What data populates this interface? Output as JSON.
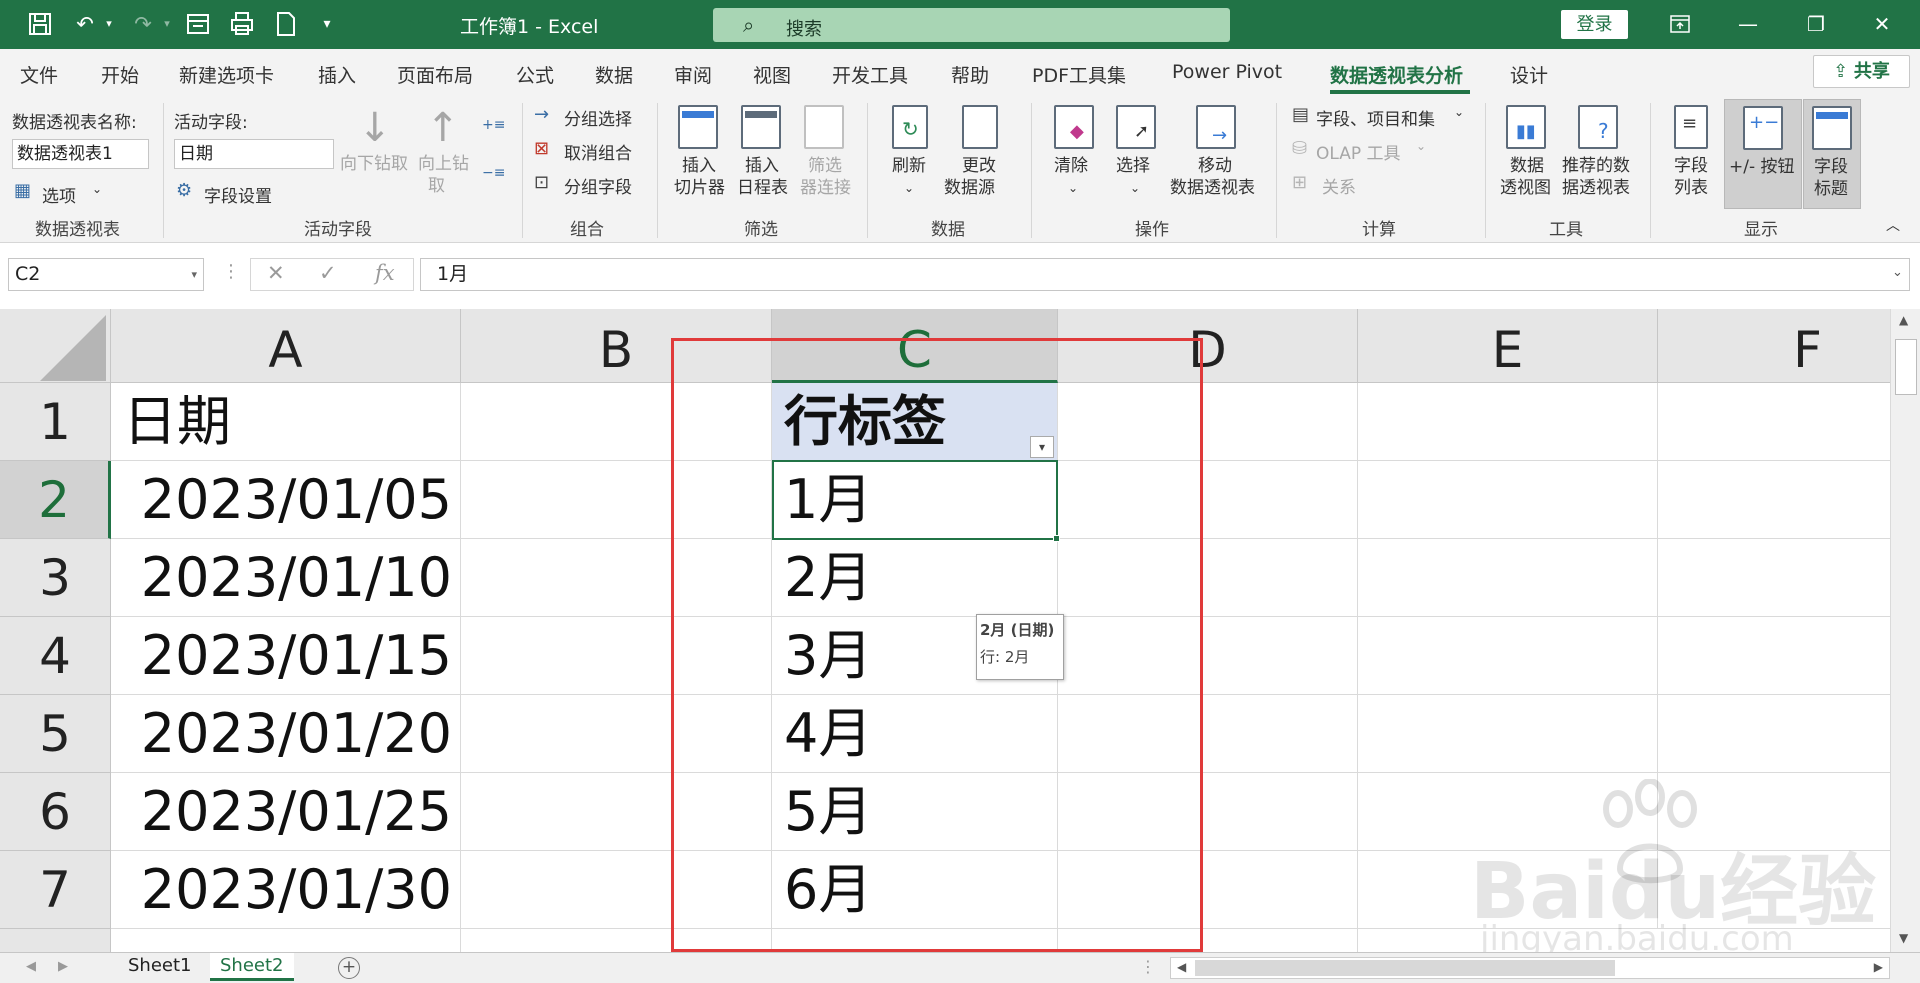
{
  "titlebar": {
    "doc_title": "工作簿1  -  Excel",
    "search_placeholder": "搜索",
    "login_label": "登录"
  },
  "menu": {
    "tabs": [
      "文件",
      "开始",
      "新建选项卡",
      "插入",
      "页面布局",
      "公式",
      "数据",
      "审阅",
      "视图",
      "开发工具",
      "帮助",
      "PDF工具集",
      "Power Pivot",
      "数据透视表分析",
      "设计"
    ],
    "active_tab": "数据透视表分析",
    "share_label": "共享"
  },
  "ribbon": {
    "pivot": {
      "name_label": "数据透视表名称:",
      "name_value": "数据透视表1",
      "options_label": "选项",
      "group_label": "数据透视表"
    },
    "active_field": {
      "label": "活动字段:",
      "value": "日期",
      "settings_label": "字段设置",
      "drill_down": "向下钻取",
      "drill_up_1": "向上钻",
      "drill_up_2": "取",
      "group_label": "活动字段"
    },
    "group": {
      "group_selection": "分组选择",
      "ungroup": "取消组合",
      "group_field": "分组字段",
      "group_label": "组合"
    },
    "filter": {
      "slicer_1": "插入",
      "slicer_2": "切片器",
      "timeline_1": "插入",
      "timeline_2": "日程表",
      "conn_1": "筛选",
      "conn_2": "器连接",
      "group_label": "筛选"
    },
    "data": {
      "refresh": "刷新",
      "change_1": "更改",
      "change_2": "数据源",
      "group_label": "数据"
    },
    "actions": {
      "clear": "清除",
      "select": "选择",
      "move_1": "移动",
      "move_2": "数据透视表",
      "group_label": "操作"
    },
    "calc": {
      "fields_items": "字段、项目和集",
      "olap": "OLAP 工具",
      "relations": "关系",
      "group_label": "计算"
    },
    "tools": {
      "chart_1": "数据",
      "chart_2": "透视图",
      "rec_1": "推荐的数",
      "rec_2": "据透视表",
      "group_label": "工具"
    },
    "show": {
      "field_list_1": "字段",
      "field_list_2": "列表",
      "buttons": "+/- 按钮",
      "headers_1": "字段",
      "headers_2": "标题",
      "group_label": "显示"
    }
  },
  "formula_bar": {
    "name_box": "C2",
    "formula": "1月"
  },
  "grid": {
    "columns": [
      "A",
      "B",
      "C",
      "D",
      "E",
      "F"
    ],
    "selected_column": "C",
    "rows": [
      {
        "num": "1",
        "a": "日期",
        "c": "行标签"
      },
      {
        "num": "2",
        "a": "2023/01/05",
        "c": "1月"
      },
      {
        "num": "3",
        "a": "2023/01/10",
        "c": "2月"
      },
      {
        "num": "4",
        "a": "2023/01/15",
        "c": "3月"
      },
      {
        "num": "5",
        "a": "2023/01/20",
        "c": "4月"
      },
      {
        "num": "6",
        "a": "2023/01/25",
        "c": "5月"
      },
      {
        "num": "7",
        "a": "2023/01/30",
        "c": "6月"
      }
    ],
    "selected_row": "2",
    "tooltip": {
      "title": "2月 (日期)",
      "body": "行: 2月"
    }
  },
  "watermark": {
    "brand": "Baidu经验",
    "url": "jingyan.baidu.com"
  },
  "sheets": {
    "tabs": [
      "Sheet1",
      "Sheet2"
    ],
    "active": "Sheet2"
  },
  "colors": {
    "excel_green": "#217346",
    "pivot_header_fill": "#d9e1f2",
    "highlight_red": "#e03a3a"
  }
}
